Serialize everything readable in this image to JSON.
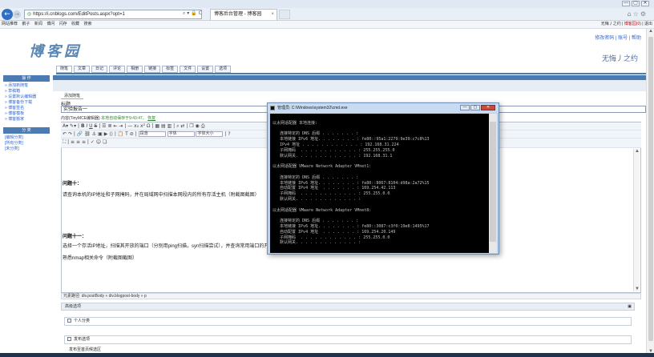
{
  "browser": {
    "window_buttons": [
      "—",
      "▢",
      "✕"
    ],
    "address": "https://i.cnblogs.com/EditPosts.aspx?opt=1",
    "tab_title": "博客后台管理 - 博客园",
    "addr_tools": "⌕ ▾ 🔒 C",
    "fav_items": [
      "网站推荐",
      "鹅子",
      "新闻",
      "博问",
      "闪存",
      "收藏",
      "搜索"
    ],
    "fav_right_user": "无悔丿之约",
    "fav_right_items": [
      "博客园(0)",
      "退出"
    ]
  },
  "page": {
    "top_links": "修改密码 | 账号 | 帮助",
    "logo": "博客园",
    "blog_name": "无悔丿之约",
    "menu": [
      "随笔",
      "文章",
      "日记",
      "评论",
      "相册",
      "链接",
      "标签",
      "文件",
      "设置",
      "选项"
    ]
  },
  "sidebar": {
    "section1_title": "操 作",
    "section1_items": [
      "» 添加新随笔",
      "» 草稿箱",
      "» 设置默认编辑器",
      "» 博客备份下载",
      "» 博客签名",
      "» 博客模板",
      "» 博客搬家"
    ],
    "section2_title": "分 类",
    "section2_items": [
      "[编辑分类]",
      "[所有分类]",
      "[未分类]"
    ]
  },
  "editor": {
    "page_heading": "添加随笔",
    "title_label": "标题",
    "title_value": "实验报告一",
    "content_label": "内容(TinyMCE编辑器)",
    "autosave": "本地自动保存于9:43:47，",
    "autosave_restore": "恢复",
    "paragraph_sel": "段落",
    "font_sel": "字体",
    "size_sel": "字体大小",
    "p1_heading": "问题十：",
    "p1_text": "请查询本机的IP地址和子网掩码，并在局域网中扫描本网段内的所有存活主机（附截图截图）",
    "p2_heading": "问题十一：",
    "p2_text": "选择一个存活IP地址，扫描其开放的端口（分别用ping扫描，syn扫描尝试），并查询常用端口的开放情况（附截图截图）",
    "p3_text": "熟悉nmap相关命令（附截图截图）",
    "path_bar": "元素路径: div.postBody » div.blogpost-body » p",
    "section_advanced": "高级选项",
    "section_personal": "个人分类",
    "section_publish": "发布选项",
    "section_sub": "发布至首页候选区"
  },
  "cmd": {
    "title": "管理员: C:\\Windows\\system32\\cmd.exe",
    "lines": [
      "",
      "以太网适配器 本地连接:",
      "",
      "   连接特定的 DNS 后缀 . . . . . . . :",
      "   本地链接 IPv6 地址. . . . . . . . : fe80::95a1:2279:9e39:c7c8%13",
      "   IPv4 地址 . . . . . . . . . . . . : 192.168.31.224",
      "   子网掩码  . . . . . . . . . . . . : 255.255.255.0",
      "   默认网关. . . . . . . . . . . . . : 192.168.31.1",
      "",
      "以太网适配器 VMware Network Adapter VMnet1:",
      "",
      "   连接特定的 DNS 后缀 . . . . . . . :",
      "   本地链接 IPv6 地址. . . . . . . . : fe80::8067:8104:d98a:2a72%15",
      "   自动配置 IPv4 地址  . . . . . . . : 169.254.42.113",
      "   子网掩码  . . . . . . . . . . . . : 255.255.0.0",
      "   默认网关. . . . . . . . . . . . . :",
      "",
      "以太网适配器 VMware Network Adapter VMnet8:",
      "",
      "   连接特定的 DNS 后缀 . . . . . . . :",
      "   本地链接 IPv6 地址. . . . . . . . : fe80::3087:c3f0:19e8:1495%17",
      "   自动配置 IPv4 地址  . . . . . . . : 169.254.20.149",
      "   子网掩码  . . . . . . . . . . . . : 255.255.0.0",
      "   默认网关. . . . . . . . . . . . . :"
    ]
  },
  "colors": {
    "accent": "#4a7cb3",
    "cmd_bg": "#000000",
    "cmd_fg": "#c0c0c0"
  }
}
